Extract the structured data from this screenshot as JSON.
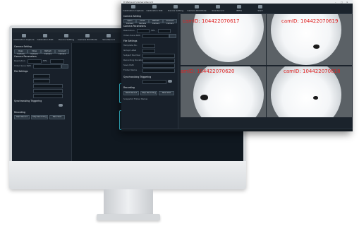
{
  "monitor_app": {
    "toolbar": [
      {
        "label": "Calibration Capture",
        "icon": "camera-calibration-icon"
      },
      {
        "label": "Calibration Edit",
        "icon": "edit-icon"
      },
      {
        "label": "Device Setting",
        "icon": "device-settings-icon"
      },
      {
        "label": "Camera ROI Mode",
        "icon": "roi-icon"
      },
      {
        "label": "Size Record",
        "icon": "record-icon"
      },
      {
        "label": "IMEIS",
        "icon": "device-icon"
      },
      {
        "label": "Start",
        "icon": "start-icon"
      }
    ],
    "camera_setting_title": "Camera Setting",
    "camera_buttons": [
      "Open Camera",
      "Close Camera",
      "Refresh Camera",
      "Connect Camera"
    ],
    "camera_parameters_title": "Camera Parameters",
    "resolution": "Resolution",
    "fps_label": "FPS",
    "video_save_path": "Video Save Path",
    "file_settings_title": "File Settings",
    "sync_title": "Synchronizing Triggering",
    "recording_title": "Recording",
    "recording_buttons": [
      "Start Record",
      "Stop Recording",
      "Take Shot"
    ]
  },
  "front_window": {
    "title": "D:\\Behavior\\Camera Record",
    "toolbar": [
      {
        "label": "Calibration Capture",
        "icon": "camera-calibration-icon"
      },
      {
        "label": "Calibration Edit",
        "icon": "edit-icon"
      },
      {
        "label": "Device Setting",
        "icon": "device-settings-icon"
      },
      {
        "label": "Camera ROI Mode",
        "icon": "roi-icon"
      },
      {
        "label": "Size Record",
        "icon": "record-icon"
      },
      {
        "label": "IMEIS",
        "icon": "device-icon"
      },
      {
        "label": "Start",
        "icon": "start-icon"
      }
    ],
    "left_panel": {
      "camera_setting": "Camera Setting",
      "buttons": [
        "Open Camera",
        "Close Camera",
        "Refresh Camera",
        "Connect Camera"
      ],
      "camera_parameters": "Camera Parameters",
      "resolution": "Resolution",
      "fps": "FPS",
      "video_save_path": "Video Save Path",
      "file_settings": "File Settings",
      "file_rows": [
        "Template No.",
        "Group Label",
        "Subject Number",
        "Recording Duration",
        "Save Path",
        "Folder Name"
      ],
      "sync": "Synchronizing Triggering",
      "recording": "Recording",
      "recording_buttons": [
        "Start Record",
        "Stop Recording",
        "Take Shot"
      ],
      "snapshot": "Snapshot Folder Below"
    },
    "cameras": [
      {
        "label": "camID: 104422070617"
      },
      {
        "label": "camID: 104422070619"
      },
      {
        "label": "camID: 104422070620"
      },
      {
        "label": "camID: 104422070618"
      }
    ]
  }
}
